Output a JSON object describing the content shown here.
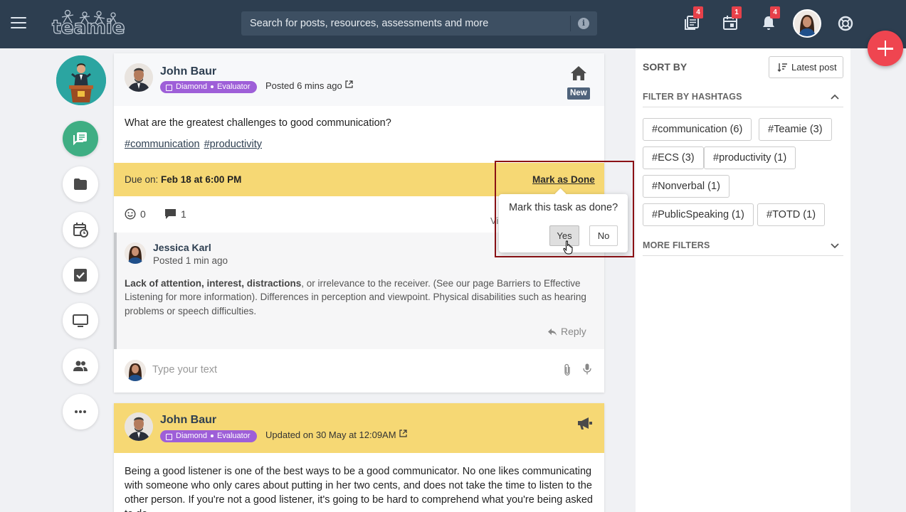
{
  "topbar": {
    "logo_text": "teamie",
    "search_placeholder": "Search for posts, resources, assessments and more",
    "badges": {
      "resources": "4",
      "calendar": "1",
      "notifications": "4"
    }
  },
  "rail": {
    "items": [
      "newsfeed",
      "folders",
      "schedule",
      "tasks",
      "presentation",
      "people",
      "more"
    ]
  },
  "post1": {
    "author": "John Baur",
    "badge_level": "Diamond",
    "badge_role": "Evaluator",
    "posted": "Posted 6 mins ago",
    "new_label": "New",
    "text": "What are the greatest challenges to good communication?",
    "hashtags": [
      "#communication",
      "#productivity"
    ],
    "due_label": "Due on: ",
    "due_date": "Feb 18 at 6:00 PM",
    "mark_done": "Mark as Done",
    "reaction_count": "0",
    "comment_count": "1",
    "view_truncated": "Vi",
    "comment": {
      "author": "Jessica Karl",
      "time": "Posted 1 min ago",
      "body_bold": "Lack of attention, interest, distractions",
      "body_rest": ", or irrelevance to the receiver. (See our page Barriers to Effective Listening for more information). Differences in perception and viewpoint. Physical disabilities such as hearing problems or speech difficulties.",
      "reply": "Reply"
    },
    "composer_placeholder": "Type your text"
  },
  "popover": {
    "question": "Mark this task as done?",
    "yes": "Yes",
    "no": "No"
  },
  "post2": {
    "author": "John Baur",
    "badge_level": "Diamond",
    "badge_role": "Evaluator",
    "updated": "Updated on 30 May at 12:09AM",
    "body": "Being a good listener is one of the best ways to be a good communicator. No one likes communicating with someone who only cares about putting in her two cents, and does not take the time to listen to the other person. If you're not a good listener, it's going to be hard to comprehend what you're being asked to do."
  },
  "sidebar": {
    "sort_by": "SORT BY",
    "sort_button": "Latest post",
    "filter_title": "FILTER BY HASHTAGS",
    "hashtags": [
      "#communication (6)",
      "#Teamie (3)",
      "#ECS (3)",
      "#productivity (1)",
      "#Nonverbal (1)",
      "#PublicSpeaking (1)",
      "#TOTD (1)"
    ],
    "more_filters": "MORE FILTERS"
  },
  "colors": {
    "topbar": "#2d3e50",
    "accent_green": "#3fae83",
    "due_yellow": "#f6d874",
    "badge_purple": "#9e5fd8",
    "fab_red": "#ef4550",
    "highlight": "#8b1115"
  }
}
